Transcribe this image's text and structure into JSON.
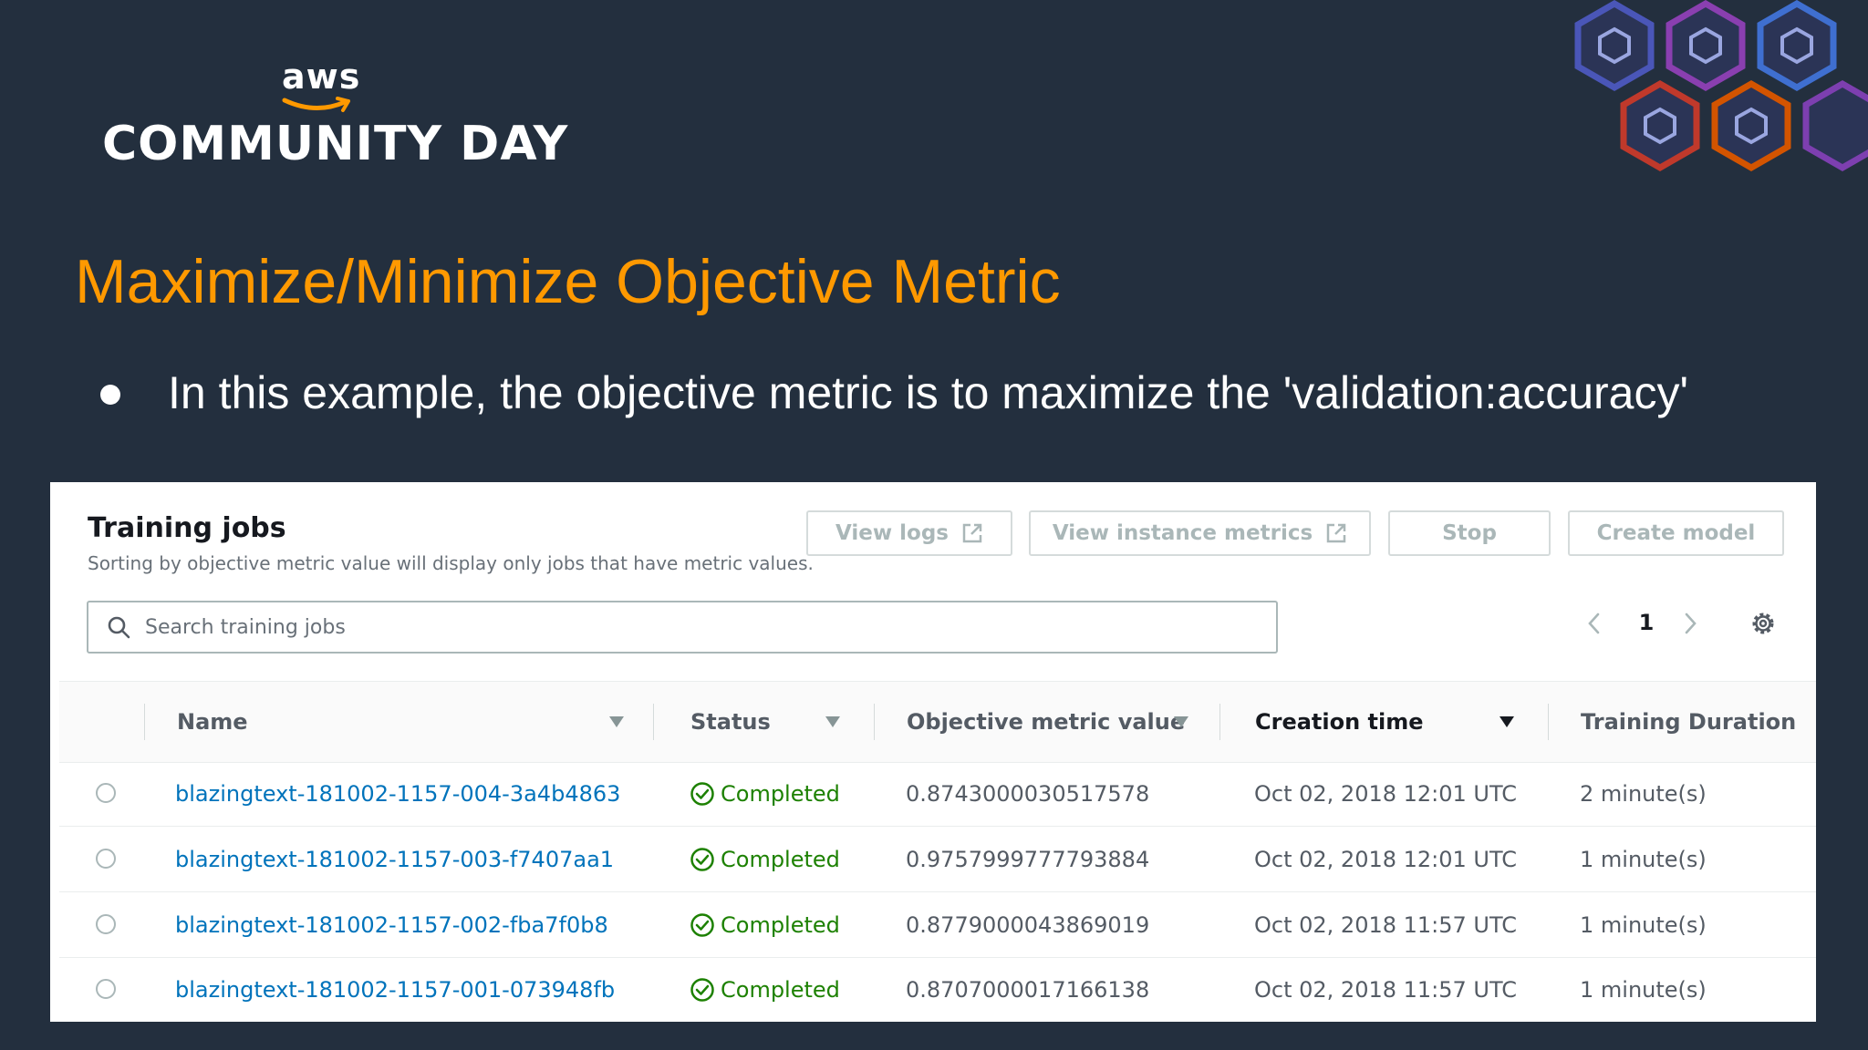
{
  "slide": {
    "logo_top": "aws",
    "logo_main": "COMMUNITY DAY",
    "title": "Maximize/Minimize Objective Metric",
    "bullet": "In this example, the objective metric is to maximize the 'validation:accuracy'"
  },
  "colors": {
    "background": "#232f3e",
    "title": "#ff9900",
    "link": "#0073bb",
    "success": "#1d8102"
  },
  "panel": {
    "title": "Training jobs",
    "subtitle": "Sorting by objective metric value will display only jobs that have metric values.",
    "buttons": {
      "view_logs": "View logs",
      "view_instance_metrics": "View instance metrics",
      "stop": "Stop",
      "create_model": "Create model"
    },
    "search": {
      "placeholder": "Search training jobs"
    },
    "pagination": {
      "current_page": "1"
    },
    "columns": {
      "name": "Name",
      "status": "Status",
      "objective_metric_value": "Objective metric value",
      "creation_time": "Creation time",
      "training_duration": "Training Duration"
    },
    "sorted_column": "creation_time",
    "rows": [
      {
        "name": "blazingtext-181002-1157-004-3a4b4863",
        "status": "Completed",
        "metric": "0.8743000030517578",
        "created": "Oct 02, 2018 12:01 UTC",
        "duration": "2 minute(s)"
      },
      {
        "name": "blazingtext-181002-1157-003-f7407aa1",
        "status": "Completed",
        "metric": "0.9757999777793884",
        "created": "Oct 02, 2018 12:01 UTC",
        "duration": "1 minute(s)"
      },
      {
        "name": "blazingtext-181002-1157-002-fba7f0b8",
        "status": "Completed",
        "metric": "0.8779000043869019",
        "created": "Oct 02, 2018 11:57 UTC",
        "duration": "1 minute(s)"
      },
      {
        "name": "blazingtext-181002-1157-001-073948fb",
        "status": "Completed",
        "metric": "0.8707000017166138",
        "created": "Oct 02, 2018 11:57 UTC",
        "duration": "1 minute(s)"
      }
    ]
  }
}
